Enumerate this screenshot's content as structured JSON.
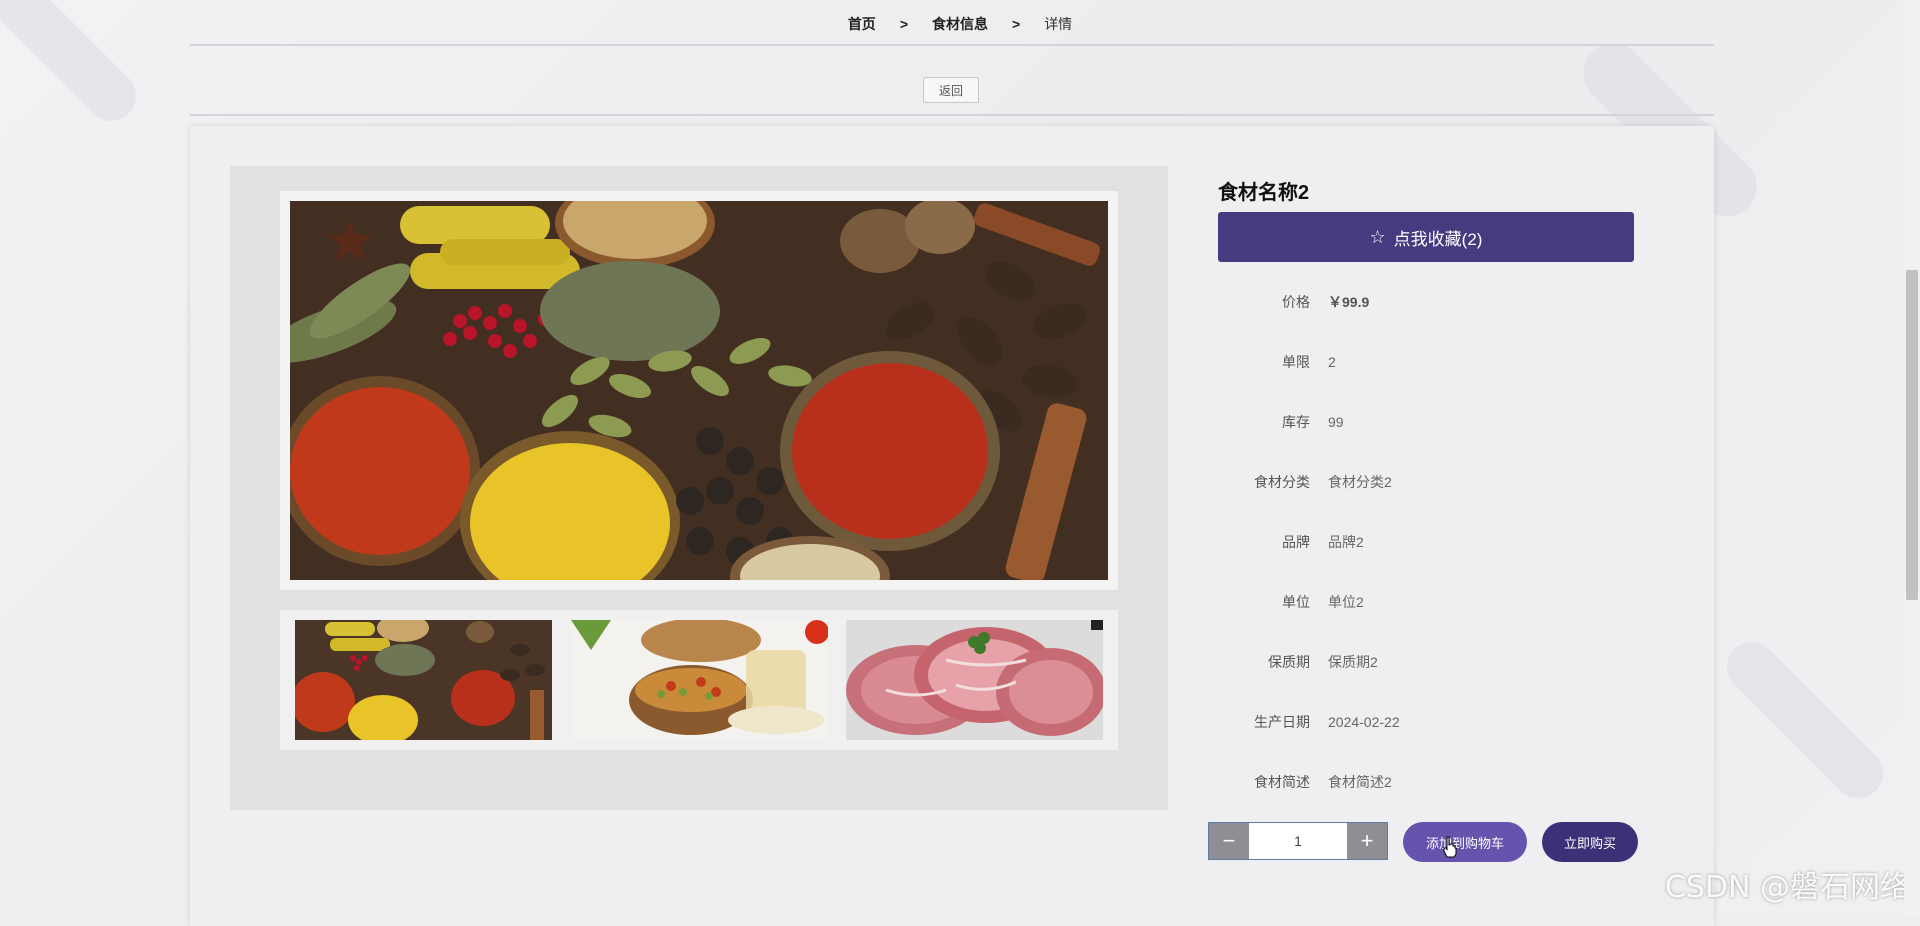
{
  "breadcrumb": {
    "home": "首页",
    "sep1": ">",
    "category": "食材信息",
    "sep2": ">",
    "current": "详情"
  },
  "back_label": "返回",
  "product": {
    "title": "食材名称2",
    "favorite_label": "点我收藏(2)",
    "fields": [
      {
        "label": "价格",
        "value": "￥99.9"
      },
      {
        "label": "单限",
        "value": "2"
      },
      {
        "label": "库存",
        "value": "99"
      },
      {
        "label": "食材分类",
        "value": "食材分类2"
      },
      {
        "label": "品牌",
        "value": "品牌2"
      },
      {
        "label": "单位",
        "value": "单位2"
      },
      {
        "label": "保质期",
        "value": "保质期2"
      },
      {
        "label": "生产日期",
        "value": "2024-02-22"
      },
      {
        "label": "食材简述",
        "value": "食材简述2"
      }
    ]
  },
  "quantity": {
    "minus": "−",
    "value": "1",
    "plus": "+"
  },
  "actions": {
    "add_to_cart": "添加到购物车",
    "buy_now": "立即购买"
  },
  "watermark": "CSDN @磐石网络",
  "colors": {
    "accent": "#473a7e",
    "cart_button": "#6553ad",
    "buy_button": "#3d2f78"
  }
}
